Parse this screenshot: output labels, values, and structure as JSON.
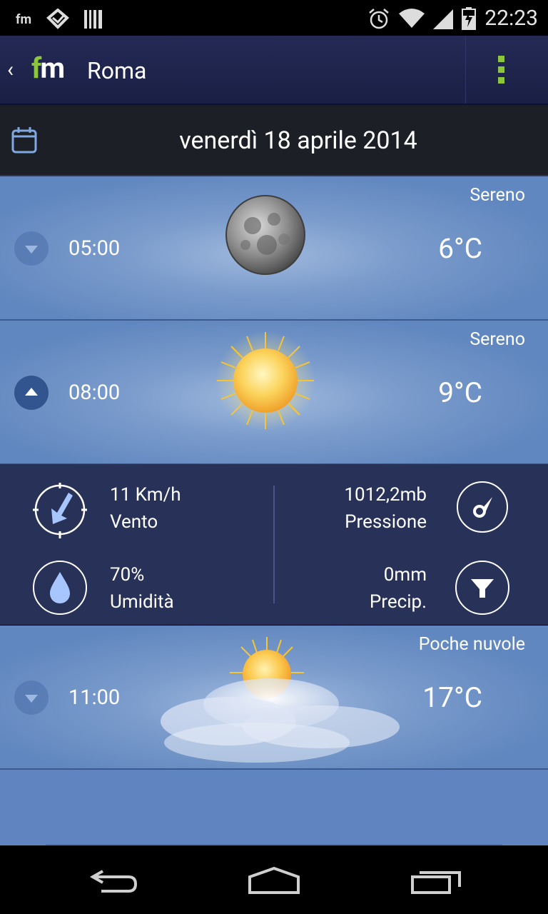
{
  "status_bar": {
    "app_badge": "fm",
    "time": "22:23"
  },
  "app_bar": {
    "logo_f": "f",
    "logo_m": "m",
    "city": "Roma"
  },
  "date_bar": {
    "date": "venerdì 18 aprile 2014"
  },
  "forecast": [
    {
      "time": "05:00",
      "condition": "Sereno",
      "temperature": "6°C",
      "icon": "moon-icon",
      "expanded": false
    },
    {
      "time": "08:00",
      "condition": "Sereno",
      "temperature": "9°C",
      "icon": "sun-icon",
      "expanded": true
    },
    {
      "time": "11:00",
      "condition": "Poche nuvole",
      "temperature": "17°C",
      "icon": "sun-cloud-icon",
      "expanded": false
    }
  ],
  "details": {
    "wind": {
      "value": "11 Km/h",
      "label": "Vento",
      "icon": "wind-compass-icon"
    },
    "pressure": {
      "value": "1012,2mb",
      "label": "Pressione",
      "icon": "gauge-icon"
    },
    "humidity": {
      "value": "70%",
      "label": "Umidità",
      "icon": "drop-icon"
    },
    "precipitation": {
      "value": "0mm",
      "label": "Precip.",
      "icon": "funnel-icon"
    }
  },
  "colors": {
    "accent": "#8cc63f",
    "app_bar": "#1f2450",
    "details_bg": "#283259",
    "row_bg": "#6187c0"
  }
}
